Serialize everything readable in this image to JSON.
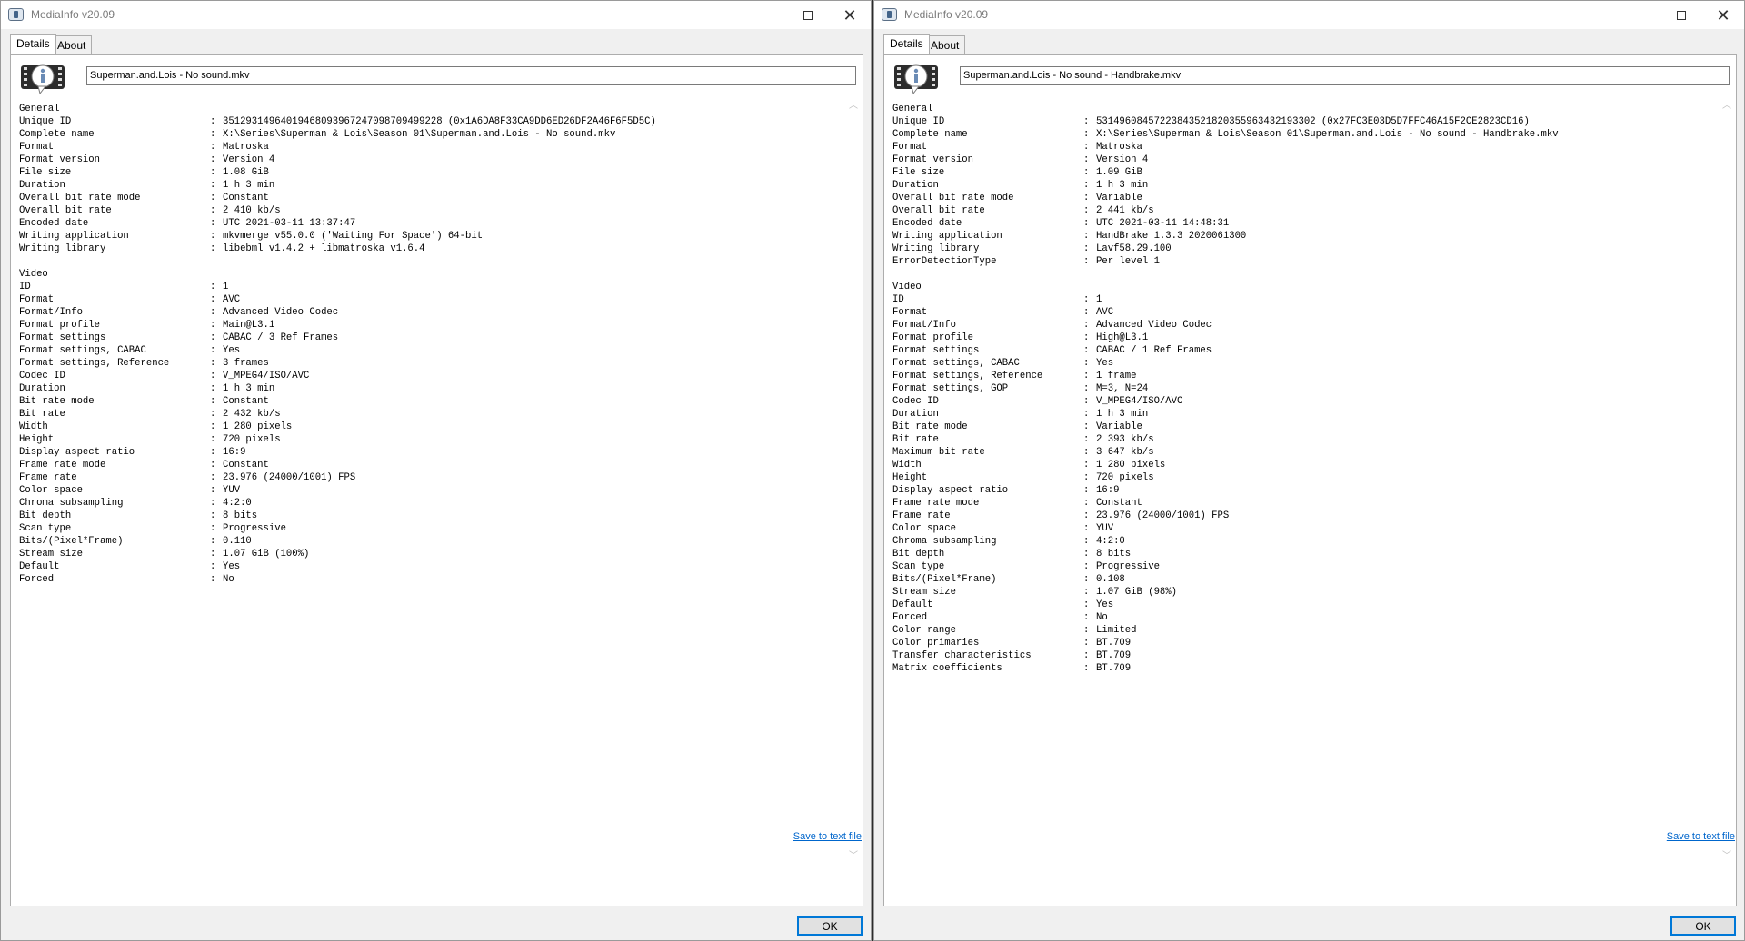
{
  "windows": [
    {
      "title": "MediaInfo v20.09",
      "tabs": [
        "Details",
        "About"
      ],
      "file_name": "Superman.and.Lois - No sound.mkv",
      "save_link": "Save to text file",
      "ok_label": "OK",
      "sections": [
        {
          "name": "General",
          "rows": [
            [
              "Unique ID",
              "35129314964019468093967247098709499228 (0x1A6DA8F33CA9DD6ED26DF2A46F6F5D5C)"
            ],
            [
              "Complete name",
              "X:\\Series\\Superman & Lois\\Season 01\\Superman.and.Lois - No sound.mkv"
            ],
            [
              "Format",
              "Matroska"
            ],
            [
              "Format version",
              "Version 4"
            ],
            [
              "File size",
              "1.08 GiB"
            ],
            [
              "Duration",
              "1 h 3 min"
            ],
            [
              "Overall bit rate mode",
              "Constant"
            ],
            [
              "Overall bit rate",
              "2 410 kb/s"
            ],
            [
              "Encoded date",
              "UTC 2021-03-11 13:37:47"
            ],
            [
              "Writing application",
              "mkvmerge v55.0.0 ('Waiting For Space') 64-bit"
            ],
            [
              "Writing library",
              "libebml v1.4.2 + libmatroska v1.6.4"
            ]
          ]
        },
        {
          "name": "Video",
          "rows": [
            [
              "ID",
              "1"
            ],
            [
              "Format",
              "AVC"
            ],
            [
              "Format/Info",
              "Advanced Video Codec"
            ],
            [
              "Format profile",
              "Main@L3.1"
            ],
            [
              "Format settings",
              "CABAC / 3 Ref Frames"
            ],
            [
              "Format settings, CABAC",
              "Yes"
            ],
            [
              "Format settings, Reference",
              "3 frames"
            ],
            [
              "Codec ID",
              "V_MPEG4/ISO/AVC"
            ],
            [
              "Duration",
              "1 h 3 min"
            ],
            [
              "Bit rate mode",
              "Constant"
            ],
            [
              "Bit rate",
              "2 432 kb/s"
            ],
            [
              "Width",
              "1 280 pixels"
            ],
            [
              "Height",
              "720 pixels"
            ],
            [
              "Display aspect ratio",
              "16:9"
            ],
            [
              "Frame rate mode",
              "Constant"
            ],
            [
              "Frame rate",
              "23.976 (24000/1001) FPS"
            ],
            [
              "Color space",
              "YUV"
            ],
            [
              "Chroma subsampling",
              "4:2:0"
            ],
            [
              "Bit depth",
              "8 bits"
            ],
            [
              "Scan type",
              "Progressive"
            ],
            [
              "Bits/(Pixel*Frame)",
              "0.110"
            ],
            [
              "Stream size",
              "1.07 GiB (100%)"
            ],
            [
              "Default",
              "Yes"
            ],
            [
              "Forced",
              "No"
            ]
          ]
        }
      ]
    },
    {
      "title": "MediaInfo v20.09",
      "tabs": [
        "Details",
        "About"
      ],
      "file_name": "Superman.and.Lois - No sound - Handbrake.mkv",
      "save_link": "Save to text file",
      "ok_label": "OK",
      "sections": [
        {
          "name": "General",
          "rows": [
            [
              "Unique ID",
              "53149608457223843521820355963432193302 (0x27FC3E03D5D7FFC46A15F2CE2823CD16)"
            ],
            [
              "Complete name",
              "X:\\Series\\Superman & Lois\\Season 01\\Superman.and.Lois - No sound - Handbrake.mkv"
            ],
            [
              "Format",
              "Matroska"
            ],
            [
              "Format version",
              "Version 4"
            ],
            [
              "File size",
              "1.09 GiB"
            ],
            [
              "Duration",
              "1 h 3 min"
            ],
            [
              "Overall bit rate mode",
              "Variable"
            ],
            [
              "Overall bit rate",
              "2 441 kb/s"
            ],
            [
              "Encoded date",
              "UTC 2021-03-11 14:48:31"
            ],
            [
              "Writing application",
              "HandBrake 1.3.3 2020061300"
            ],
            [
              "Writing library",
              "Lavf58.29.100"
            ],
            [
              "ErrorDetectionType",
              "Per level 1"
            ]
          ]
        },
        {
          "name": "Video",
          "rows": [
            [
              "ID",
              "1"
            ],
            [
              "Format",
              "AVC"
            ],
            [
              "Format/Info",
              "Advanced Video Codec"
            ],
            [
              "Format profile",
              "High@L3.1"
            ],
            [
              "Format settings",
              "CABAC / 1 Ref Frames"
            ],
            [
              "Format settings, CABAC",
              "Yes"
            ],
            [
              "Format settings, Reference",
              "1 frame"
            ],
            [
              "Format settings, GOP",
              "M=3, N=24"
            ],
            [
              "Codec ID",
              "V_MPEG4/ISO/AVC"
            ],
            [
              "Duration",
              "1 h 3 min"
            ],
            [
              "Bit rate mode",
              "Variable"
            ],
            [
              "Bit rate",
              "2 393 kb/s"
            ],
            [
              "Maximum bit rate",
              "3 647 kb/s"
            ],
            [
              "Width",
              "1 280 pixels"
            ],
            [
              "Height",
              "720 pixels"
            ],
            [
              "Display aspect ratio",
              "16:9"
            ],
            [
              "Frame rate mode",
              "Constant"
            ],
            [
              "Frame rate",
              "23.976 (24000/1001) FPS"
            ],
            [
              "Color space",
              "YUV"
            ],
            [
              "Chroma subsampling",
              "4:2:0"
            ],
            [
              "Bit depth",
              "8 bits"
            ],
            [
              "Scan type",
              "Progressive"
            ],
            [
              "Bits/(Pixel*Frame)",
              "0.108"
            ],
            [
              "Stream size",
              "1.07 GiB (98%)"
            ],
            [
              "Default",
              "Yes"
            ],
            [
              "Forced",
              "No"
            ],
            [
              "Color range",
              "Limited"
            ],
            [
              "Color primaries",
              "BT.709"
            ],
            [
              "Transfer characteristics",
              "BT.709"
            ],
            [
              "Matrix coefficients",
              "BT.709"
            ]
          ]
        }
      ]
    }
  ]
}
